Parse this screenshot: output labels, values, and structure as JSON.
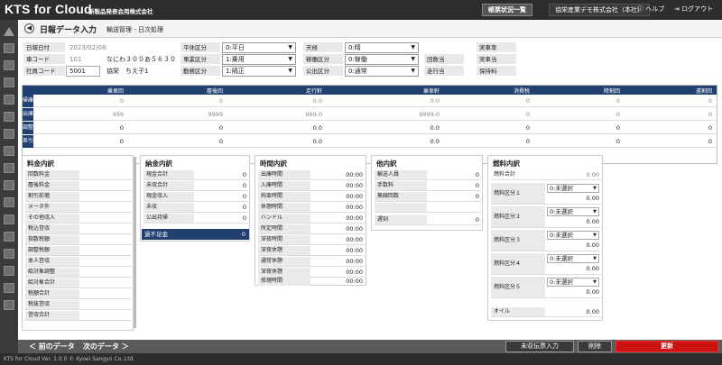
{
  "topbar": {
    "app": "KTS for Cloud",
    "company": "新製品発表会用株式会社",
    "report_btn": "帳票状況一覧",
    "company_btn": "協栄産業デモ株式会社（本社）",
    "help": "ヘルプ",
    "logout": "ログアウト"
  },
  "header": {
    "title": "日報データ入力",
    "subtitle": "輸送管理 - 日次処理"
  },
  "form": {
    "date_label": "日報日付",
    "date_value": "2023/02/08",
    "car_label": "車コード",
    "car_code": "101",
    "car_plate": "なにわ３００あ５６３０",
    "emp_label": "社員コード",
    "emp_code": "5001",
    "emp_name": "協栄　ちえ子1",
    "holiday_label": "平休区分",
    "holiday_value": "0:平日",
    "biz_label": "事業区分",
    "biz_value": "1:乗用",
    "shift_label": "勤務区分",
    "shift_value": "1:隔正",
    "weather_label": "天候",
    "weather_value": "0:晴",
    "op_label": "稼働区分",
    "op_value": "0:稼働",
    "pub_label": "公出区分",
    "pub_value": "0:通常",
    "count_label": "回数当",
    "run_label": "走行当",
    "act_label": "実車率",
    "biz2_label": "実車当",
    "keep_label": "保持料"
  },
  "summary": {
    "headers": [
      "乗車回",
      "層後回",
      "走行軒",
      "乗車軒",
      "消費税",
      "障割回",
      "遠割回"
    ],
    "rows": [
      {
        "label": "帰庫",
        "values": [
          "0",
          "0",
          "0.0",
          "0.0",
          "0",
          "0",
          "0"
        ]
      },
      {
        "label": "出庫",
        "values": [
          "999",
          "9999",
          "999.0",
          "9999.0",
          "0",
          "0",
          "0"
        ]
      },
      {
        "label": "調整",
        "values": [
          "0",
          "0",
          "0.0",
          "0.0",
          "0",
          "0",
          "0"
        ]
      },
      {
        "label": "差引",
        "values": [
          "0",
          "0",
          "0.0",
          "0.0",
          "0",
          "0",
          "0"
        ]
      }
    ]
  },
  "fare": {
    "title": "料金内訳",
    "rows": [
      [
        "回数料金",
        ""
      ],
      [
        "層後料金",
        ""
      ],
      [
        "割引前増",
        ""
      ],
      [
        "メータ外",
        ""
      ],
      [
        "その他収入",
        ""
      ],
      [
        "税込営収",
        ""
      ],
      [
        "指数税額",
        ""
      ],
      [
        "調整税額",
        ""
      ],
      [
        "本人営収",
        ""
      ],
      [
        "給対象調整",
        ""
      ],
      [
        "給対象合計",
        ""
      ],
      [
        "税額合計",
        ""
      ],
      [
        "税抜営収",
        ""
      ],
      [
        "営収合計",
        ""
      ]
    ]
  },
  "payment": {
    "title": "納金内訳",
    "rows": [
      [
        "現金合計",
        "0"
      ],
      [
        "未収合計",
        "0"
      ],
      [
        "現金収入",
        "0"
      ],
      [
        "未収",
        "0"
      ],
      [
        "公出持帰",
        "0"
      ]
    ],
    "shortage_label": "過不足金",
    "shortage_value": "0"
  },
  "time": {
    "title": "時間内訳",
    "rows": [
      [
        "出庫時間",
        "00:00"
      ],
      [
        "入庫時間",
        "00:00"
      ],
      [
        "拘束時間",
        "00:00"
      ],
      [
        "休憩時間",
        "00:00"
      ],
      [
        "ハンドル",
        "00:00"
      ],
      [
        "所定時間",
        "00:00"
      ],
      [
        "深夜時間",
        "00:00"
      ],
      [
        "深夜休憩",
        "00:00"
      ],
      [
        "通常休憩",
        "00:00"
      ],
      [
        "深夜休憩",
        "00:00"
      ],
      [
        "修理時間",
        "00:00"
      ]
    ]
  },
  "other": {
    "title": "他内訳",
    "rows": [
      [
        "輸送人員",
        "0"
      ],
      [
        "手数料",
        "0"
      ],
      [
        "無線回数",
        "0"
      ],
      [
        "",
        ""
      ],
      [
        "遅刻",
        "0"
      ]
    ]
  },
  "fuel": {
    "title": "燃料内訳",
    "total_label": "燃料合計",
    "total_value": "0.00",
    "groups": [
      {
        "label": "燃料区分１",
        "select": "0:未選択",
        "value": "0.00"
      },
      {
        "label": "燃料区分２",
        "select": "0:未選択",
        "value": "0.00"
      },
      {
        "label": "燃料区分３",
        "select": "0:未選択",
        "value": "0.00"
      },
      {
        "label": "燃料区分４",
        "select": "0:未選択",
        "value": "0.00"
      },
      {
        "label": "燃料区分５",
        "select": "0:未選択",
        "value": "0.00"
      }
    ],
    "oil_label": "オイル",
    "oil_value": "0.00"
  },
  "footer": {
    "prev": "＜ 前のデータ",
    "next": "次のデータ ＞",
    "uncollected": "未収伝票入力",
    "delete": "削除",
    "update": "更新"
  },
  "copyright": "KTS for Cloud Ver. 1.0.0 © Kyoei Sangyo Co.,Ltd."
}
